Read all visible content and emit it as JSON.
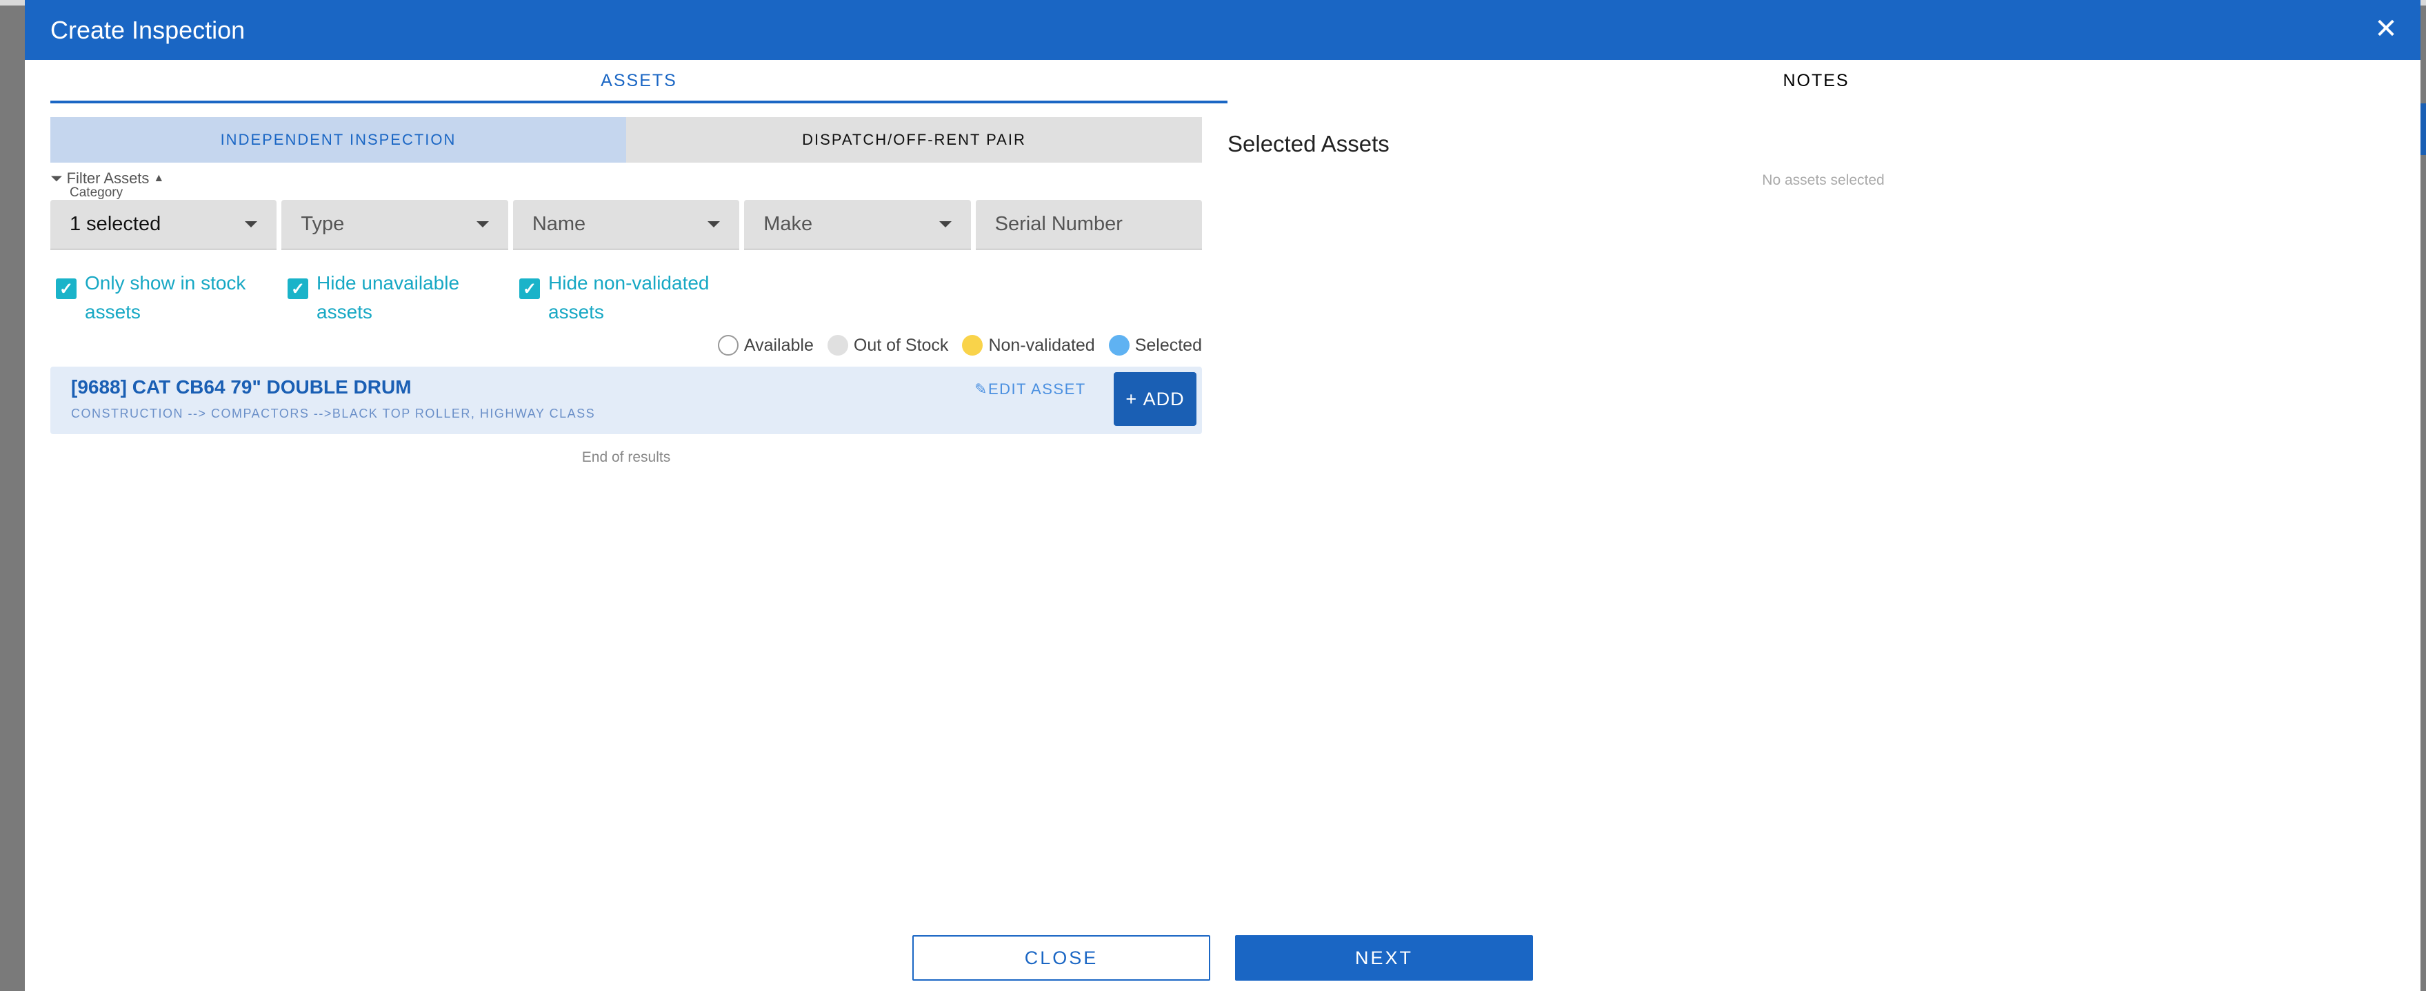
{
  "dialog": {
    "title": "Create Inspection"
  },
  "tabs": [
    {
      "label": "ASSETS"
    },
    {
      "label": "NOTES"
    }
  ],
  "mode": {
    "independent": "INDEPENDENT INSPECTION",
    "pair": "DISPATCH/OFF-RENT PAIR"
  },
  "filter": {
    "toggle_label": "Filter Assets",
    "category_label": "Category",
    "category_value": "1 selected",
    "type_placeholder": "Type",
    "name_placeholder": "Name",
    "make_placeholder": "Make",
    "serial_placeholder": "Serial Number"
  },
  "checkboxes": [
    {
      "label": "Only show in stock assets",
      "checked": true
    },
    {
      "label": "Hide unavailable assets",
      "checked": true
    },
    {
      "label": "Hide non-validated assets",
      "checked": true
    }
  ],
  "legend": [
    {
      "label": "Available",
      "color": "#ffffff"
    },
    {
      "label": "Out of Stock",
      "color": "#e0e0e0"
    },
    {
      "label": "Non-validated",
      "color": "#f9d34a"
    },
    {
      "label": "Selected",
      "color": "#5fb2f2"
    }
  ],
  "assets": [
    {
      "title": "[9688] CAT CB64 79\" DOUBLE DRUM",
      "path": "CONSTRUCTION --> COMPACTORS -->BLACK TOP ROLLER, HIGHWAY CLASS",
      "edit_label": "EDIT ASSET",
      "add_label": "ADD"
    }
  ],
  "end_of_results": "End of results",
  "selected": {
    "title": "Selected Assets",
    "empty": "No assets selected"
  },
  "footer": {
    "close_label": "CLOSE",
    "next_label": "NEXT"
  }
}
